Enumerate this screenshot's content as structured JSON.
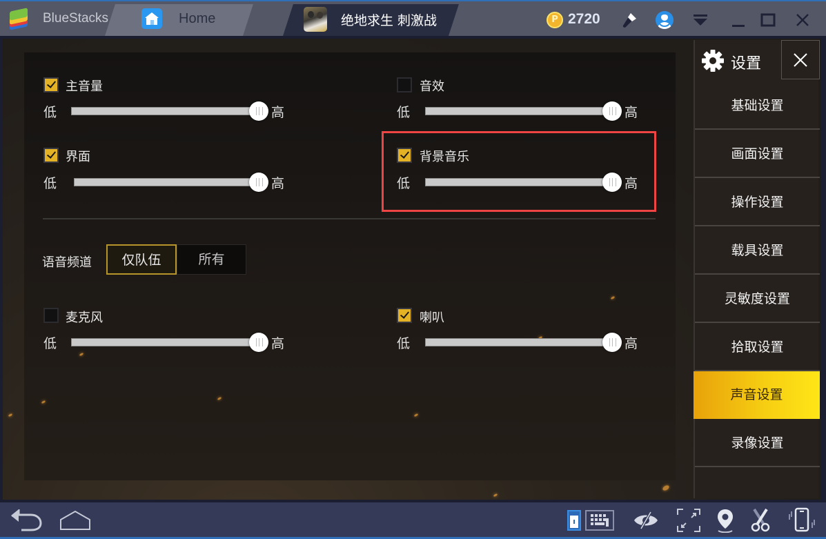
{
  "titlebar": {
    "brand": "BlueStacks",
    "tabs": [
      {
        "label": "Home",
        "icon": "home-icon"
      },
      {
        "label": "绝地求生 刺激战",
        "icon": "game-thumbnail"
      }
    ],
    "coin_symbol": "P",
    "coins": "2720",
    "icons": [
      "brush-icon",
      "account-icon",
      "menu-icon",
      "minimize-icon",
      "maximize-icon",
      "close-icon"
    ]
  },
  "settings": {
    "title": "设置",
    "menu": [
      {
        "label": "基础设置",
        "active": false
      },
      {
        "label": "画面设置",
        "active": false
      },
      {
        "label": "操作设置",
        "active": false
      },
      {
        "label": "载具设置",
        "active": false
      },
      {
        "label": "灵敏度设置",
        "active": false
      },
      {
        "label": "拾取设置",
        "active": false
      },
      {
        "label": "声音设置",
        "active": true
      },
      {
        "label": "录像设置",
        "active": false
      }
    ],
    "colors": {
      "active_start": "#e8a20a",
      "active_end": "#ffe617",
      "checkbox_on": "#e3b325",
      "highlight_box": "#ee4444"
    }
  },
  "sound": {
    "low_label": "低",
    "high_label": "高",
    "sliders": [
      {
        "label": "主音量",
        "checked": true,
        "value_pct": 100
      },
      {
        "label": "音效",
        "checked": false,
        "value_pct": 100
      },
      {
        "label": "界面",
        "checked": true,
        "value_pct": 100
      },
      {
        "label": "背景音乐",
        "checked": true,
        "value_pct": 100,
        "highlighted": true
      },
      {
        "label": "麦克风",
        "checked": false,
        "value_pct": 100
      },
      {
        "label": "喇叭",
        "checked": true,
        "value_pct": 100
      }
    ],
    "voice_channel": {
      "label": "语音频道",
      "options": [
        "仅队伍",
        "所有"
      ],
      "selected": "仅队伍"
    }
  },
  "bottombar": {
    "icons": [
      "back-icon",
      "home-icon",
      "portrait-mode-icon",
      "keyboard-icon",
      "hide-icon",
      "fullscreen-icon",
      "location-icon",
      "screenshot-scissors-icon",
      "shake-icon"
    ]
  }
}
